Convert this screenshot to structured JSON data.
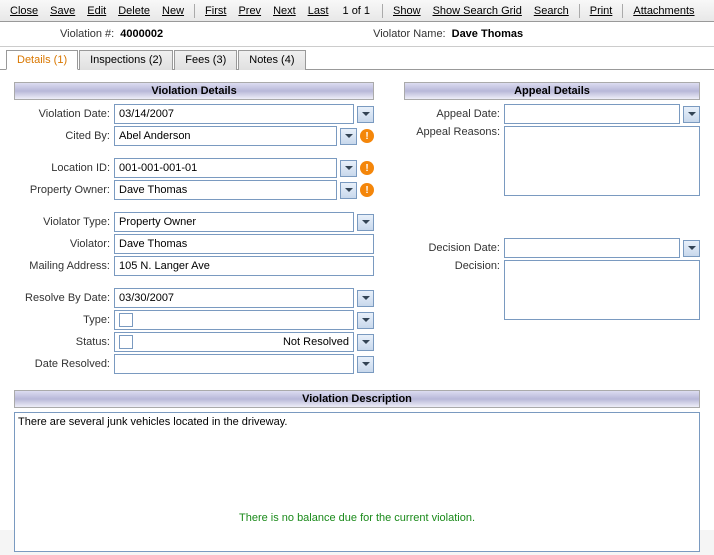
{
  "toolbar": {
    "close": "Close",
    "save": "Save",
    "edit": "Edit",
    "delete": "Delete",
    "new": "New",
    "first": "First",
    "prev": "Prev",
    "next": "Next",
    "last": "Last",
    "counter": "1 of 1",
    "show": "Show",
    "show_search_grid": "Show Search Grid",
    "search": "Search",
    "print": "Print",
    "attachments": "Attachments"
  },
  "header": {
    "violation_num_label": "Violation #:",
    "violation_num": "4000002",
    "violator_name_label": "Violator Name:",
    "violator_name": "Dave Thomas"
  },
  "tabs": {
    "details": "Details (1)",
    "inspections": "Inspections (2)",
    "fees": "Fees (3)",
    "notes": "Notes (4)"
  },
  "sections": {
    "violation_details": "Violation Details",
    "appeal_details": "Appeal Details",
    "violation_description": "Violation Description"
  },
  "fields": {
    "violation_date_label": "Violation Date:",
    "violation_date": "03/14/2007",
    "cited_by_label": "Cited By:",
    "cited_by": "Abel Anderson",
    "location_id_label": "Location ID:",
    "location_id": "001-001-001-01",
    "property_owner_label": "Property Owner:",
    "property_owner": "Dave Thomas",
    "violator_type_label": "Violator Type:",
    "violator_type": "Property Owner",
    "violator_label": "Violator:",
    "violator": "Dave Thomas",
    "mailing_address_label": "Mailing Address:",
    "mailing_address": "105 N. Langer Ave",
    "resolve_by_label": "Resolve By Date:",
    "resolve_by": "03/30/2007",
    "type_label": "Type:",
    "type": "",
    "status_label": "Status:",
    "status": "Not Resolved",
    "date_resolved_label": "Date Resolved:",
    "date_resolved": "",
    "appeal_date_label": "Appeal Date:",
    "appeal_date": "",
    "appeal_reasons_label": "Appeal Reasons:",
    "appeal_reasons": "",
    "decision_date_label": "Decision Date:",
    "decision_date": "",
    "decision_label": "Decision:",
    "decision": ""
  },
  "description": "There are several junk vehicles located in the driveway.",
  "footer_status": "There is no balance due for the current violation."
}
